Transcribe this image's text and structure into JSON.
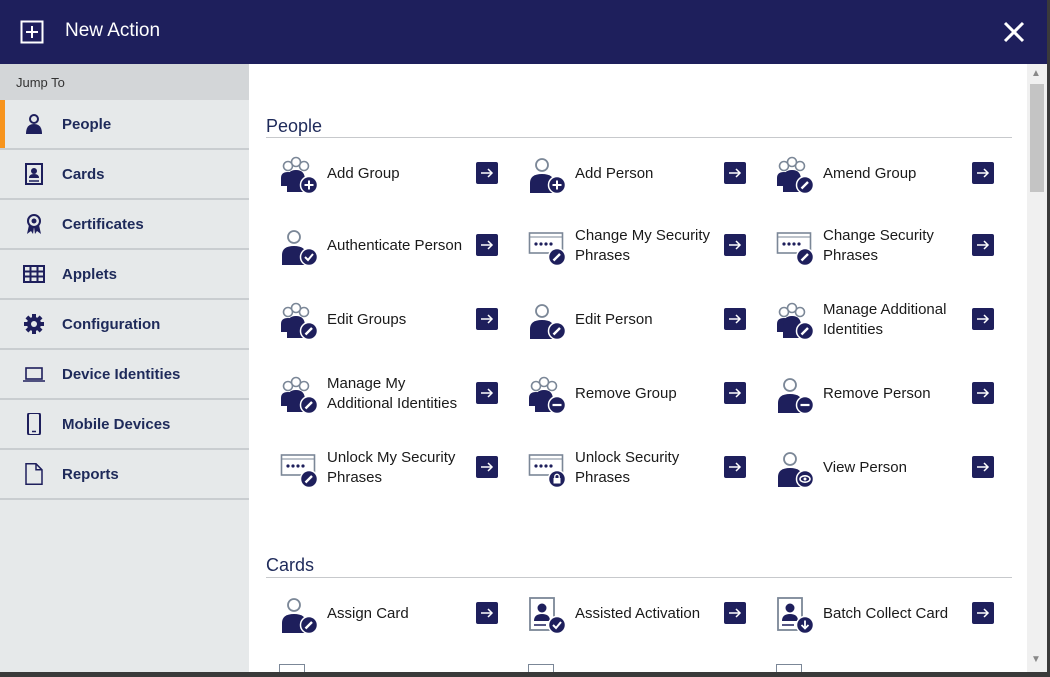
{
  "window": {
    "title": "New Action"
  },
  "sidebar": {
    "header": "Jump To",
    "items": [
      {
        "label": "People",
        "icon": "person-icon"
      },
      {
        "label": "Cards",
        "icon": "card-icon"
      },
      {
        "label": "Certificates",
        "icon": "ribbon-icon"
      },
      {
        "label": "Applets",
        "icon": "grid-icon"
      },
      {
        "label": "Configuration",
        "icon": "gear-icon"
      },
      {
        "label": "Device Identities",
        "icon": "laptop-icon"
      },
      {
        "label": "Mobile Devices",
        "icon": "phone-icon"
      },
      {
        "label": "Reports",
        "icon": "document-icon"
      }
    ]
  },
  "sections": {
    "people": {
      "title": "People",
      "actions": [
        {
          "label": "Add Group",
          "icon": "group-add-icon"
        },
        {
          "label": "Add Person",
          "icon": "person-add-icon"
        },
        {
          "label": "Amend Group",
          "icon": "group-edit-icon"
        },
        {
          "label": "Authenticate Person",
          "icon": "person-check-icon"
        },
        {
          "label": "Change My Security Phrases",
          "icon": "phrase-edit-icon"
        },
        {
          "label": "Change Security Phrases",
          "icon": "phrase-edit-icon"
        },
        {
          "label": "Edit Groups",
          "icon": "group-edit-icon"
        },
        {
          "label": "Edit Person",
          "icon": "person-edit-icon"
        },
        {
          "label": "Manage Additional Identities",
          "icon": "group-edit-icon"
        },
        {
          "label": "Manage My Additional Identities",
          "icon": "group-edit-icon"
        },
        {
          "label": "Remove Group",
          "icon": "group-remove-icon"
        },
        {
          "label": "Remove Person",
          "icon": "person-remove-icon"
        },
        {
          "label": "Unlock My Security Phrases",
          "icon": "phrase-edit-icon"
        },
        {
          "label": "Unlock Security Phrases",
          "icon": "phrase-lock-icon"
        },
        {
          "label": "View Person",
          "icon": "person-view-icon"
        }
      ]
    },
    "cards": {
      "title": "Cards",
      "actions": [
        {
          "label": "Assign Card",
          "icon": "person-edit-icon"
        },
        {
          "label": "Assisted Activation",
          "icon": "card-check-icon"
        },
        {
          "label": "Batch Collect Card",
          "icon": "card-download-icon"
        }
      ]
    }
  },
  "colors": {
    "titlebar": "#1e1f5c",
    "accent": "#f7941d",
    "navText": "#1e2a5a",
    "iconGrey": "#7b8797",
    "iconNavy": "#1e1f5c"
  }
}
